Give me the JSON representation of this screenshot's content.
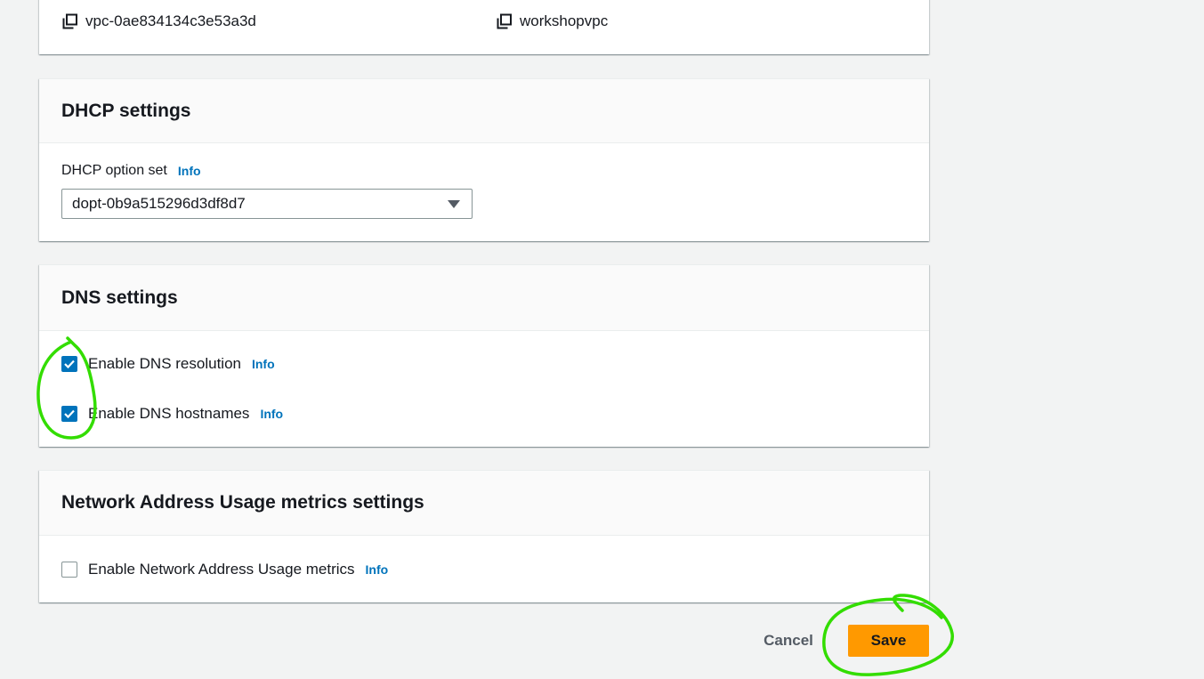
{
  "vpc_details": {
    "vpc_id": "vpc-0ae834134c3e53a3d",
    "vpc_name": "workshopvpc"
  },
  "dhcp": {
    "title": "DHCP settings",
    "option_set_label": "DHCP option set",
    "info": "Info",
    "selected_value": "dopt-0b9a515296d3df8d7"
  },
  "dns": {
    "title": "DNS settings",
    "resolution_label": "Enable DNS resolution",
    "resolution_checked": true,
    "hostnames_label": "Enable DNS hostnames",
    "hostnames_checked": true,
    "info": "Info"
  },
  "nau": {
    "title": "Network Address Usage metrics settings",
    "enable_label": "Enable Network Address Usage metrics",
    "enable_checked": false,
    "info": "Info"
  },
  "actions": {
    "cancel_label": "Cancel",
    "save_label": "Save"
  },
  "colors": {
    "primary_button": "#ff9900",
    "link": "#0073bb",
    "annotation": "#33dd00"
  }
}
